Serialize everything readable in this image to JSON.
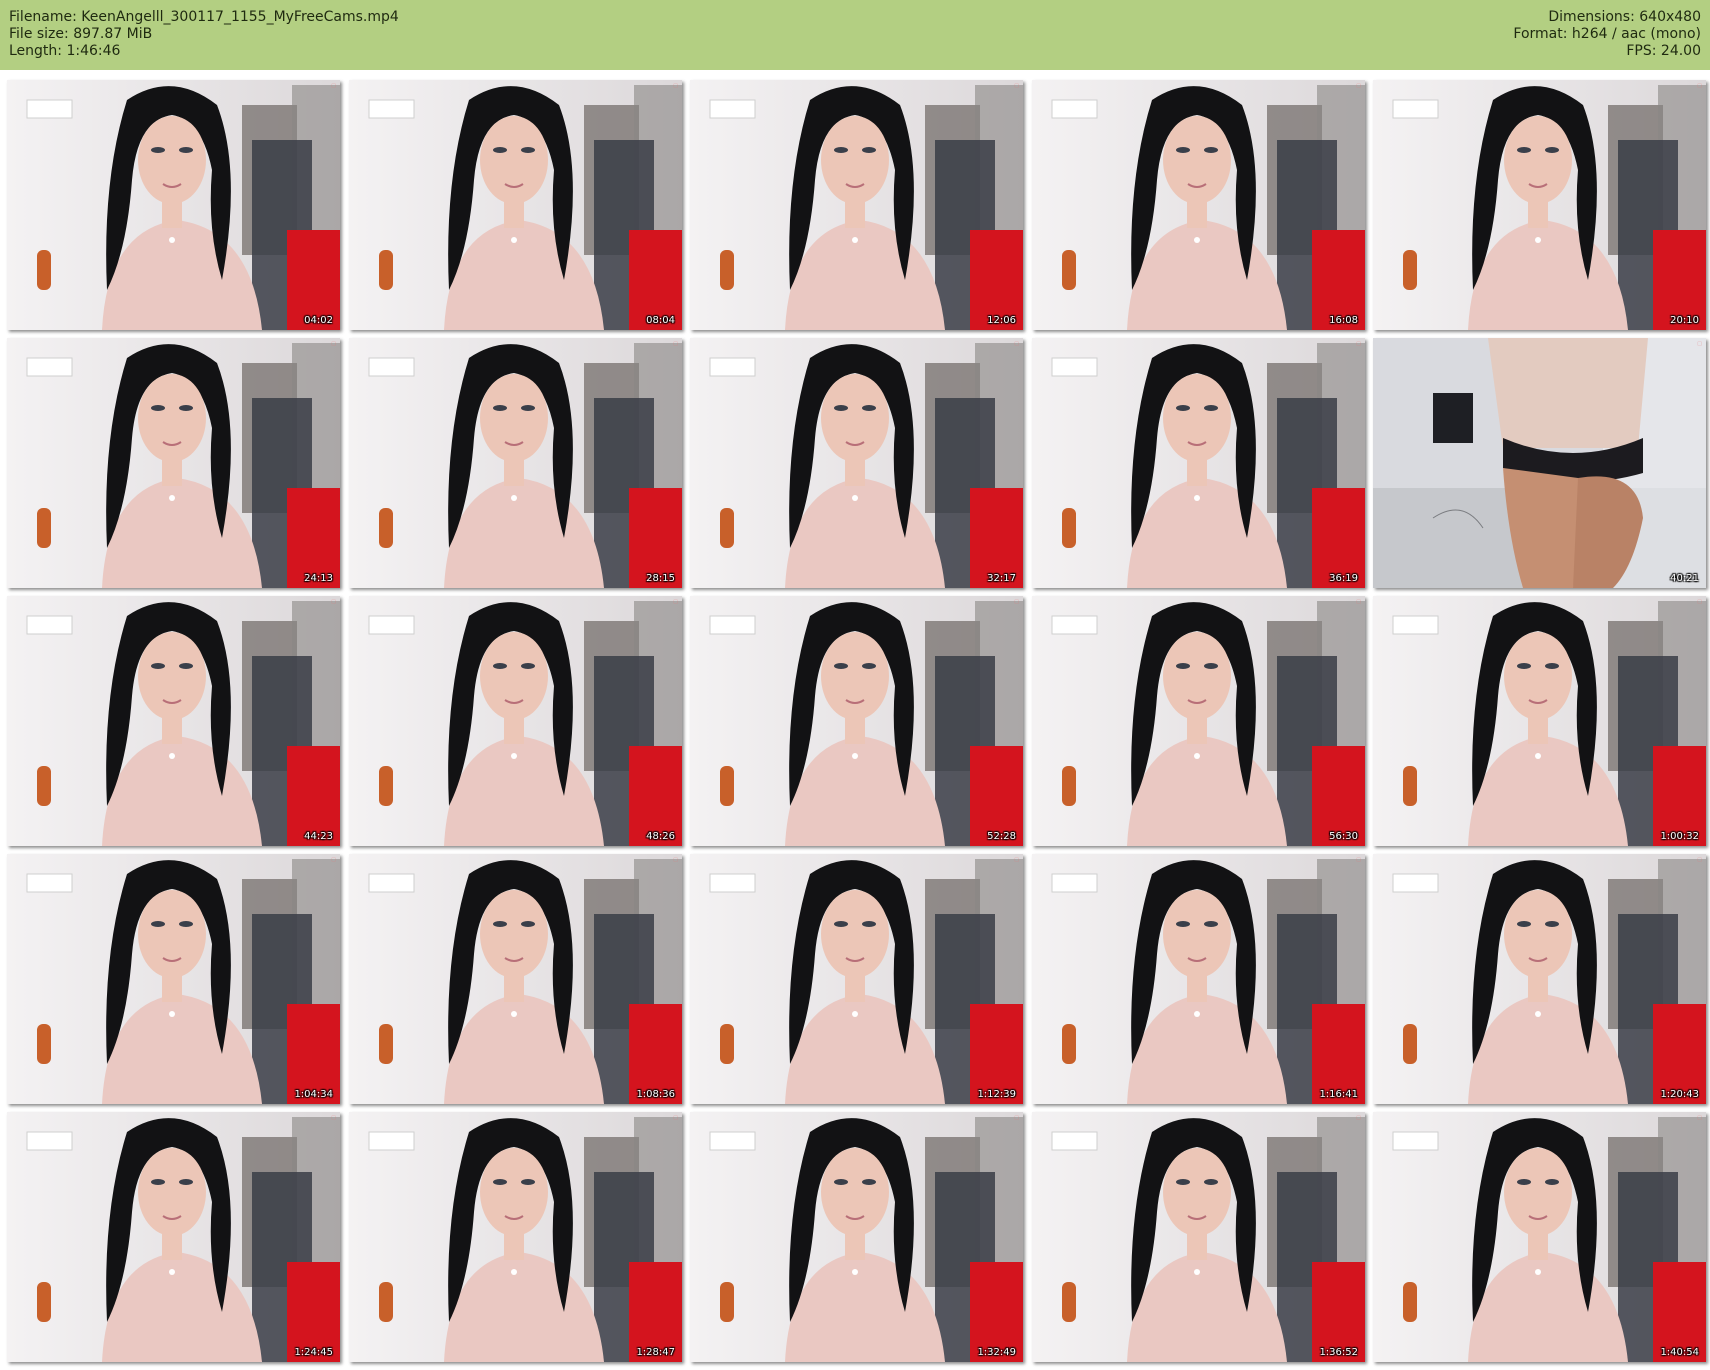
{
  "info": {
    "filename_line": "Filename: KeenAngelll_300117_1155_MyFreeCams.mp4",
    "filesize_line": "File size: 897.87 MiB",
    "length_line": "Length: 1:46:46",
    "dimensions_line": "Dimensions: 640x480",
    "format_line": "Format: h264 / aac (mono)",
    "fps_line": "FPS: 24.00"
  },
  "colors": {
    "header_bg": "#b3cf82",
    "page_bg": "#ffffff",
    "timestamp_text": "#ffffff"
  },
  "thumbnails": [
    {
      "timestamp": "04:02",
      "scene": "seated-portrait"
    },
    {
      "timestamp": "08:04",
      "scene": "seated-portrait"
    },
    {
      "timestamp": "12:06",
      "scene": "seated-portrait"
    },
    {
      "timestamp": "16:08",
      "scene": "seated-portrait"
    },
    {
      "timestamp": "20:10",
      "scene": "seated-portrait"
    },
    {
      "timestamp": "24:13",
      "scene": "seated-portrait"
    },
    {
      "timestamp": "28:15",
      "scene": "seated-portrait"
    },
    {
      "timestamp": "32:17",
      "scene": "seated-portrait"
    },
    {
      "timestamp": "36:19",
      "scene": "seated-portrait"
    },
    {
      "timestamp": "40:21",
      "scene": "standing-room"
    },
    {
      "timestamp": "44:23",
      "scene": "seated-portrait"
    },
    {
      "timestamp": "48:26",
      "scene": "seated-portrait"
    },
    {
      "timestamp": "52:28",
      "scene": "seated-portrait"
    },
    {
      "timestamp": "56:30",
      "scene": "seated-portrait"
    },
    {
      "timestamp": "1:00:32",
      "scene": "seated-portrait"
    },
    {
      "timestamp": "1:04:34",
      "scene": "seated-portrait"
    },
    {
      "timestamp": "1:08:36",
      "scene": "seated-portrait"
    },
    {
      "timestamp": "1:12:39",
      "scene": "seated-portrait"
    },
    {
      "timestamp": "1:16:41",
      "scene": "seated-portrait"
    },
    {
      "timestamp": "1:20:43",
      "scene": "seated-portrait"
    },
    {
      "timestamp": "1:24:45",
      "scene": "seated-portrait"
    },
    {
      "timestamp": "1:28:47",
      "scene": "seated-portrait"
    },
    {
      "timestamp": "1:32:49",
      "scene": "seated-portrait"
    },
    {
      "timestamp": "1:36:52",
      "scene": "seated-portrait"
    },
    {
      "timestamp": "1:40:54",
      "scene": "seated-portrait"
    }
  ]
}
